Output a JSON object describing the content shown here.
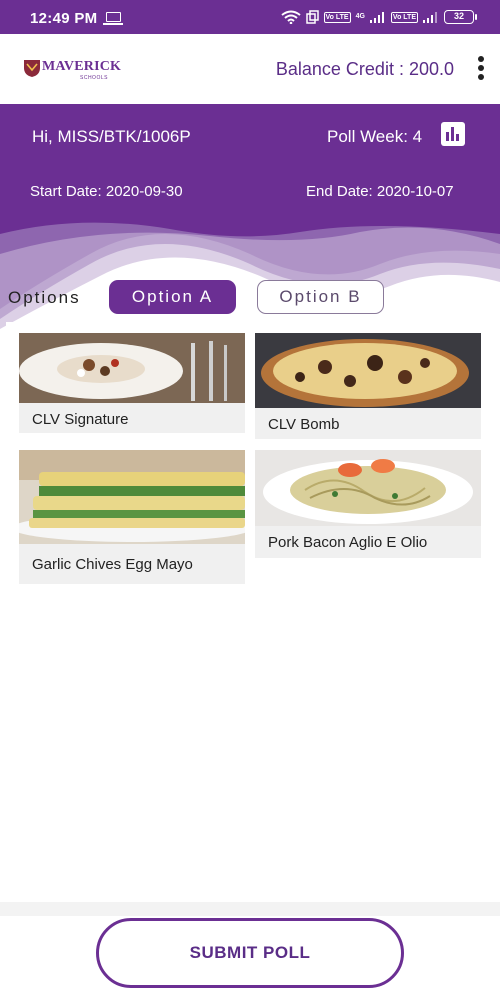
{
  "status_bar": {
    "time": "12:49 PM",
    "sim1": "Vo LTE",
    "net": "4G",
    "sim2": "Vo LTE",
    "battery": "32"
  },
  "header": {
    "logo_text": "MAVERICK",
    "logo_sub": "SCHOOLS",
    "balance_credit": "Balance Credit : 200.0"
  },
  "banner": {
    "greeting": "Hi, MISS/BTK/1006P",
    "poll_week": "Poll Week: 4",
    "start_date": "Start Date: 2020-09-30",
    "end_date": "End Date: 2020-10-07"
  },
  "options": {
    "label": "Options",
    "tabs": [
      {
        "label": "Option A",
        "selected": true
      },
      {
        "label": "Option B",
        "selected": false
      }
    ]
  },
  "menu_items": [
    {
      "name": "CLV Signature"
    },
    {
      "name": "CLV Bomb"
    },
    {
      "name": "Garlic Chives Egg Mayo"
    },
    {
      "name": "Pork Bacon Aglio E Olio"
    }
  ],
  "submit_label": "SUBMIT POLL",
  "colors": {
    "primary": "#6b2f93",
    "accent_text": "#5a2d87"
  }
}
